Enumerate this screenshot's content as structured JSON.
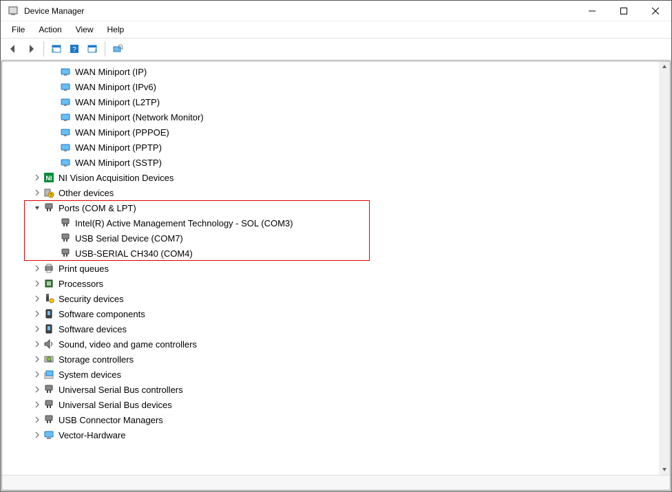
{
  "window": {
    "title": "Device Manager"
  },
  "menu": {
    "file": "File",
    "action": "Action",
    "view": "View",
    "help": "Help"
  },
  "toolbar_icons": [
    "back",
    "forward",
    "|",
    "show-hidden",
    "help",
    "properties",
    "scan"
  ],
  "tree": [
    {
      "level": 2,
      "exp": "none",
      "icon": "net",
      "label": "WAN Miniport (IP)"
    },
    {
      "level": 2,
      "exp": "none",
      "icon": "net",
      "label": "WAN Miniport (IPv6)"
    },
    {
      "level": 2,
      "exp": "none",
      "icon": "net",
      "label": "WAN Miniport (L2TP)"
    },
    {
      "level": 2,
      "exp": "none",
      "icon": "net",
      "label": "WAN Miniport (Network Monitor)"
    },
    {
      "level": 2,
      "exp": "none",
      "icon": "net",
      "label": "WAN Miniport (PPPOE)"
    },
    {
      "level": 2,
      "exp": "none",
      "icon": "net",
      "label": "WAN Miniport (PPTP)"
    },
    {
      "level": 2,
      "exp": "none",
      "icon": "net",
      "label": "WAN Miniport (SSTP)"
    },
    {
      "level": 1,
      "exp": "col",
      "icon": "ni",
      "label": "NI Vision Acquisition Devices"
    },
    {
      "level": 1,
      "exp": "col",
      "icon": "warn",
      "label": "Other devices"
    },
    {
      "level": 1,
      "exp": "exp",
      "icon": "port",
      "label": "Ports (COM & LPT)",
      "group_start": true
    },
    {
      "level": 2,
      "exp": "none",
      "icon": "port",
      "label": "Intel(R) Active Management Technology - SOL (COM3)"
    },
    {
      "level": 2,
      "exp": "none",
      "icon": "port",
      "label": "USB Serial Device (COM7)"
    },
    {
      "level": 2,
      "exp": "none",
      "icon": "port",
      "label": "USB-SERIAL CH340 (COM4)",
      "group_end": true
    },
    {
      "level": 1,
      "exp": "col",
      "icon": "print",
      "label": "Print queues"
    },
    {
      "level": 1,
      "exp": "col",
      "icon": "cpu",
      "label": "Processors"
    },
    {
      "level": 1,
      "exp": "col",
      "icon": "sec",
      "label": "Security devices"
    },
    {
      "level": 1,
      "exp": "col",
      "icon": "soft",
      "label": "Software components"
    },
    {
      "level": 1,
      "exp": "col",
      "icon": "soft",
      "label": "Software devices"
    },
    {
      "level": 1,
      "exp": "col",
      "icon": "audio",
      "label": "Sound, video and game controllers"
    },
    {
      "level": 1,
      "exp": "col",
      "icon": "stor",
      "label": "Storage controllers"
    },
    {
      "level": 1,
      "exp": "col",
      "icon": "sys",
      "label": "System devices"
    },
    {
      "level": 1,
      "exp": "col",
      "icon": "usb",
      "label": "Universal Serial Bus controllers"
    },
    {
      "level": 1,
      "exp": "col",
      "icon": "usb",
      "label": "Universal Serial Bus devices"
    },
    {
      "level": 1,
      "exp": "col",
      "icon": "usb",
      "label": "USB Connector Managers"
    },
    {
      "level": 1,
      "exp": "col",
      "icon": "mon",
      "label": "Vector-Hardware"
    }
  ]
}
